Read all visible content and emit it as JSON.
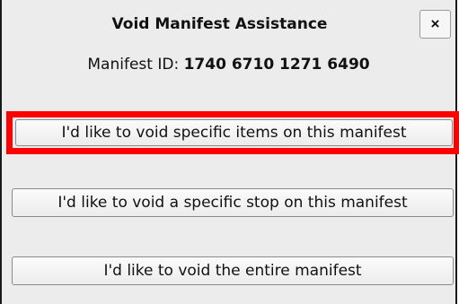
{
  "dialog": {
    "title": "Void Manifest Assistance",
    "close_label": "×",
    "manifest_label": "Manifest ID: ",
    "manifest_id": "1740 6710 1271 6490"
  },
  "options": [
    {
      "label": "I'd like to void specific items on this manifest",
      "highlighted": true
    },
    {
      "label": "I'd like to void a specific stop on this manifest",
      "highlighted": false
    },
    {
      "label": "I'd like to void the entire manifest",
      "highlighted": false
    }
  ],
  "colors": {
    "highlight": "#ff0000",
    "background": "#ececec"
  }
}
